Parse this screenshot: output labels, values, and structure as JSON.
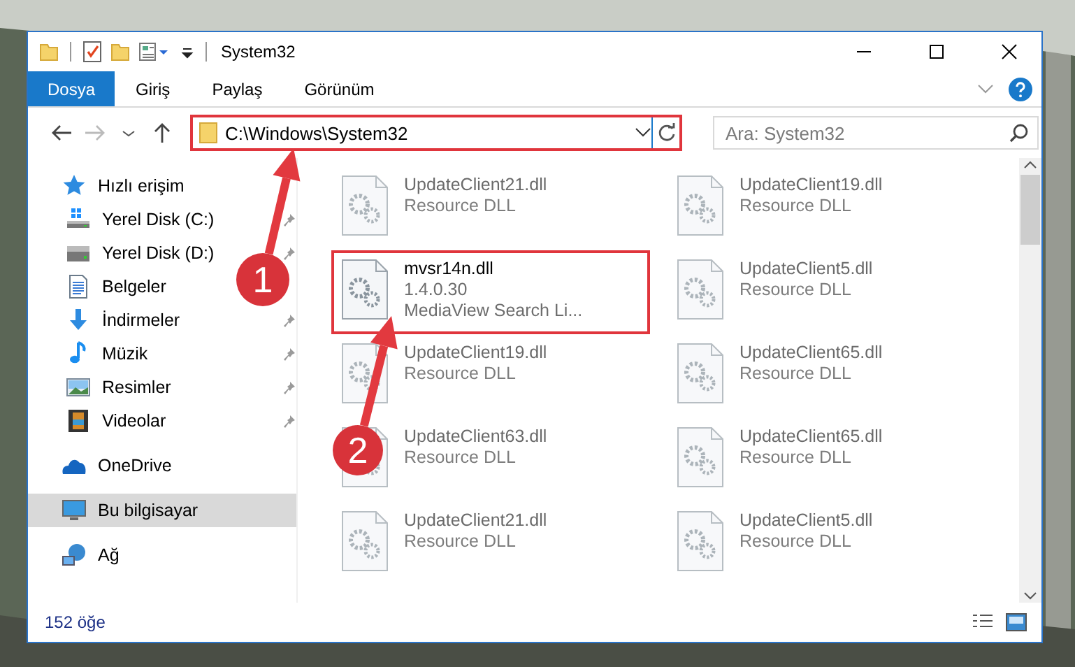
{
  "window": {
    "title": "System32"
  },
  "ribbon_tabs": [
    {
      "label": "Dosya",
      "selected": true
    },
    {
      "label": "Giriş",
      "selected": false
    },
    {
      "label": "Paylaş",
      "selected": false
    },
    {
      "label": "Görünüm",
      "selected": false
    }
  ],
  "address": {
    "path": "C:\\Windows\\System32",
    "highlighted": true
  },
  "search": {
    "placeholder": "Ara: System32"
  },
  "sidebar": {
    "items": [
      {
        "label": "Hızlı erişim",
        "kind": "star",
        "selected": false,
        "children": [
          {
            "label": "Yerel Disk (C:)",
            "kind": "system-drive",
            "pinned": true
          },
          {
            "label": "Yerel Disk (D:)",
            "kind": "drive",
            "pinned": true
          },
          {
            "label": "Belgeler",
            "kind": "documents"
          },
          {
            "label": "İndirmeler",
            "kind": "downloads",
            "pinned": true
          },
          {
            "label": "Müzik",
            "kind": "music",
            "pinned": true
          },
          {
            "label": "Resimler",
            "kind": "pictures",
            "pinned": true
          },
          {
            "label": "Videolar",
            "kind": "videos",
            "pinned": true
          }
        ]
      },
      {
        "label": "OneDrive",
        "kind": "cloud",
        "selected": false
      },
      {
        "label": "Bu bilgisayar",
        "kind": "computer",
        "selected": true
      },
      {
        "label": "Ağ",
        "kind": "network",
        "selected": false
      }
    ]
  },
  "files": [
    {
      "lines": [
        "UpdateClient21.dll",
        "Resource DLL"
      ],
      "highlighted": false,
      "dimmed": true
    },
    {
      "lines": [
        "UpdateClient19.dll",
        "Resource DLL"
      ],
      "highlighted": false,
      "dimmed": true
    },
    {
      "lines": [
        "mvsr14n.dll",
        "1.4.0.30",
        "MediaView Search Li..."
      ],
      "highlighted": true,
      "dimmed": false
    },
    {
      "lines": [
        "UpdateClient5.dll",
        "Resource DLL"
      ],
      "highlighted": false,
      "dimmed": true
    },
    {
      "lines": [
        "UpdateClient19.dll",
        "Resource DLL"
      ],
      "highlighted": false,
      "dimmed": true
    },
    {
      "lines": [
        "UpdateClient65.dll",
        "Resource DLL"
      ],
      "highlighted": false,
      "dimmed": true
    },
    {
      "lines": [
        "UpdateClient63.dll",
        "Resource DLL"
      ],
      "highlighted": false,
      "dimmed": true
    },
    {
      "lines": [
        "UpdateClient65.dll",
        "Resource DLL"
      ],
      "highlighted": false,
      "dimmed": true
    },
    {
      "lines": [
        "UpdateClient21.dll",
        "Resource DLL"
      ],
      "highlighted": false,
      "dimmed": true
    },
    {
      "lines": [
        "UpdateClient5.dll",
        "Resource DLL"
      ],
      "highlighted": false,
      "dimmed": true
    }
  ],
  "status_bar": {
    "item_count": "152 öğe"
  },
  "callouts": [
    {
      "number": "1"
    },
    {
      "number": "2"
    }
  ]
}
